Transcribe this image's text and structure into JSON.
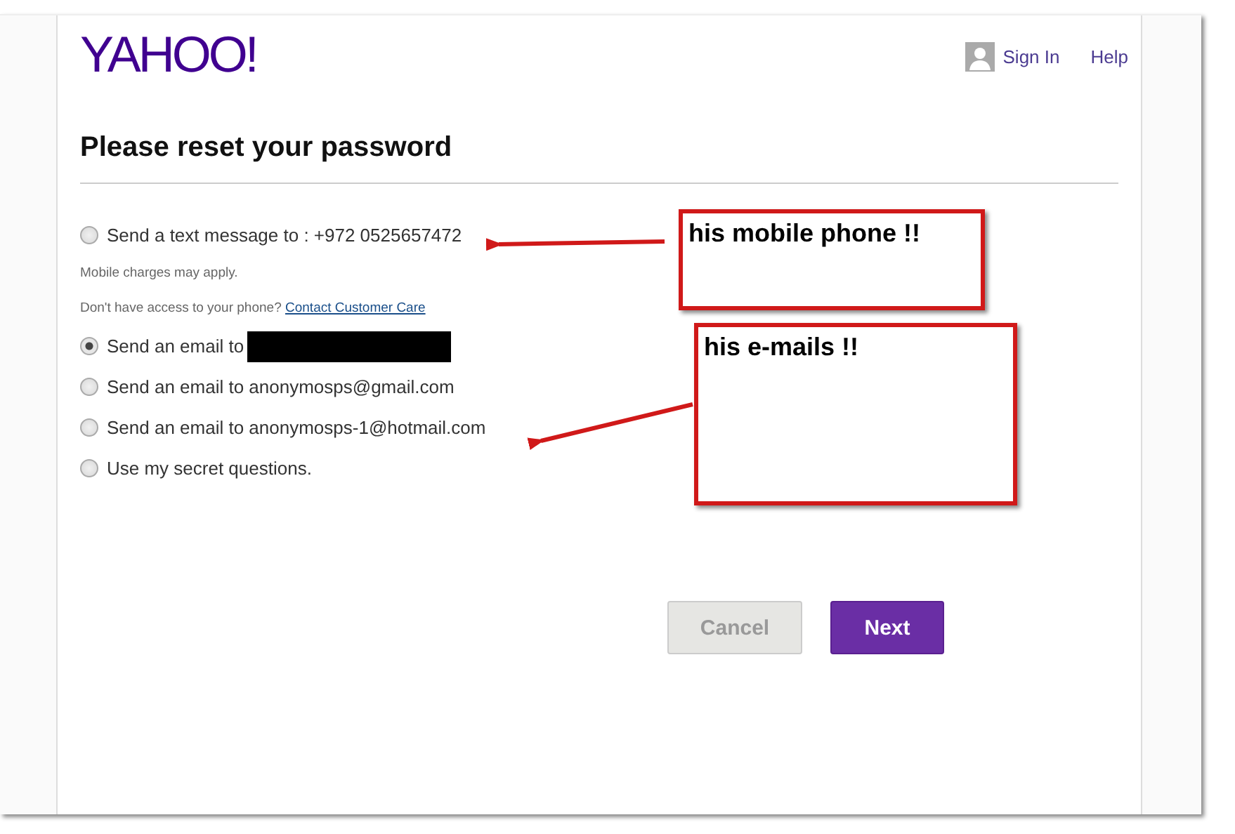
{
  "header": {
    "logo": "YAHOO!",
    "sign_in": "Sign In",
    "help": "Help"
  },
  "title": "Please reset your password",
  "options": [
    {
      "label": "Send a text message to : +972 0525657472",
      "selected": false,
      "redacted": false,
      "notes": [
        {
          "text": "Mobile charges may apply."
        },
        {
          "text": "Don't have access to your phone?",
          "link": "Contact Customer Care"
        }
      ]
    },
    {
      "label": "Send an email to",
      "selected": true,
      "redacted": true
    },
    {
      "label": "Send an email to anonymosps@gmail.com",
      "selected": false,
      "redacted": false
    },
    {
      "label": "Send an email to anonymosps-1@hotmail.com",
      "selected": false,
      "redacted": false
    },
    {
      "label": "Use my secret questions.",
      "selected": false,
      "redacted": false
    }
  ],
  "buttons": [
    {
      "label": "Cancel",
      "kind": "secondary"
    },
    {
      "label": "Next",
      "kind": "primary"
    }
  ],
  "annotations": [
    {
      "text": "his mobile phone !!"
    },
    {
      "text": "his e-mails !!"
    }
  ]
}
